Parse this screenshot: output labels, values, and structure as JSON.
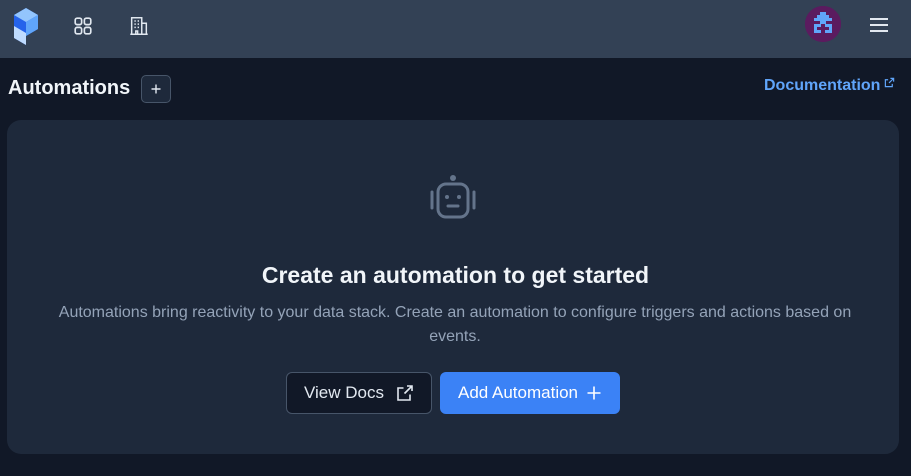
{
  "header": {
    "logo_icon": "prefect-logo-icon",
    "dashboard_icon": "grid-icon",
    "workspace_icon": "building-icon",
    "avatar_icon": "user-avatar-icon",
    "menu_icon": "hamburger-menu-icon"
  },
  "page": {
    "title": "Automations",
    "add_button_label": "+",
    "documentation_link": "Documentation"
  },
  "empty_state": {
    "icon": "robot-icon",
    "title": "Create an automation to get started",
    "description": "Automations bring reactivity to your data stack. Create an automation to configure triggers and actions based on events.",
    "view_docs_label": "View Docs",
    "add_automation_label": "Add Automation"
  },
  "colors": {
    "topbar": "#334155",
    "background": "#111827",
    "card": "#1e293b",
    "accent": "#3b82f6",
    "link": "#60a5fa"
  }
}
